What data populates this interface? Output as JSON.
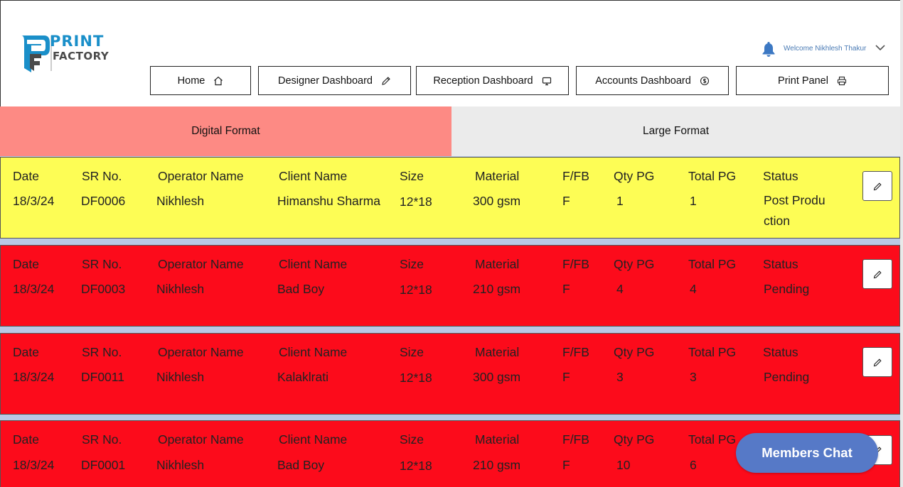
{
  "brand": {
    "line1": "PRINT",
    "line2": "FACTORY"
  },
  "header": {
    "welcome": "Welcome Nikhlesh Thakur"
  },
  "nav": {
    "home": "Home",
    "designer": "Designer Dashboard",
    "reception": "Reception Dashboard",
    "accounts": "Accounts Dashboard",
    "print": "Print Panel"
  },
  "tabs": {
    "digital": "Digital Format",
    "large": "Large Format"
  },
  "columns": [
    "Date",
    "SR No.",
    "Operator Name",
    "Client Name",
    "Size",
    "Material",
    "F/FB",
    "Qty PG",
    "Total PG",
    "Status"
  ],
  "jobs": [
    {
      "date": "18/3/24",
      "sr": "DF0006",
      "operator": "Nikhlesh",
      "client": "Himanshu Sharma",
      "size": "12*18",
      "material": "300 gsm",
      "ffb": "F",
      "qty": "1",
      "total": "1",
      "status": "Post Production"
    },
    {
      "date": "18/3/24",
      "sr": "DF0003",
      "operator": "Nikhlesh",
      "client": "Bad Boy",
      "size": "12*18",
      "material": "210 gsm",
      "ffb": "F",
      "qty": "4",
      "total": "4",
      "status": "Pending"
    },
    {
      "date": "18/3/24",
      "sr": "DF0011",
      "operator": "Nikhlesh",
      "client": "Kalaklrati",
      "size": "12*18",
      "material": "300 gsm",
      "ffb": "F",
      "qty": "3",
      "total": "3",
      "status": "Pending"
    },
    {
      "date": "18/3/24",
      "sr": "DF0001",
      "operator": "Nikhlesh",
      "client": "Bad Boy",
      "size": "12*18",
      "material": "210 gsm",
      "ffb": "F",
      "qty": "10",
      "total": "6",
      "status": ""
    }
  ],
  "chat": {
    "label": "Members Chat"
  },
  "colors": {
    "brand_blue": "#1a8fc9",
    "digital_tab": "#fd8a84",
    "post_production": "#fdfd55",
    "pending": "#fc0b1b",
    "chat": "#5679c7"
  },
  "icons": {
    "bell": "bell-icon",
    "chevron": "chevron-down-icon",
    "home": "home-icon",
    "designer": "pencil-icon",
    "reception": "monitor-icon",
    "accounts": "dollar-circle-icon",
    "print": "printer-icon",
    "edit": "edit-icon"
  }
}
